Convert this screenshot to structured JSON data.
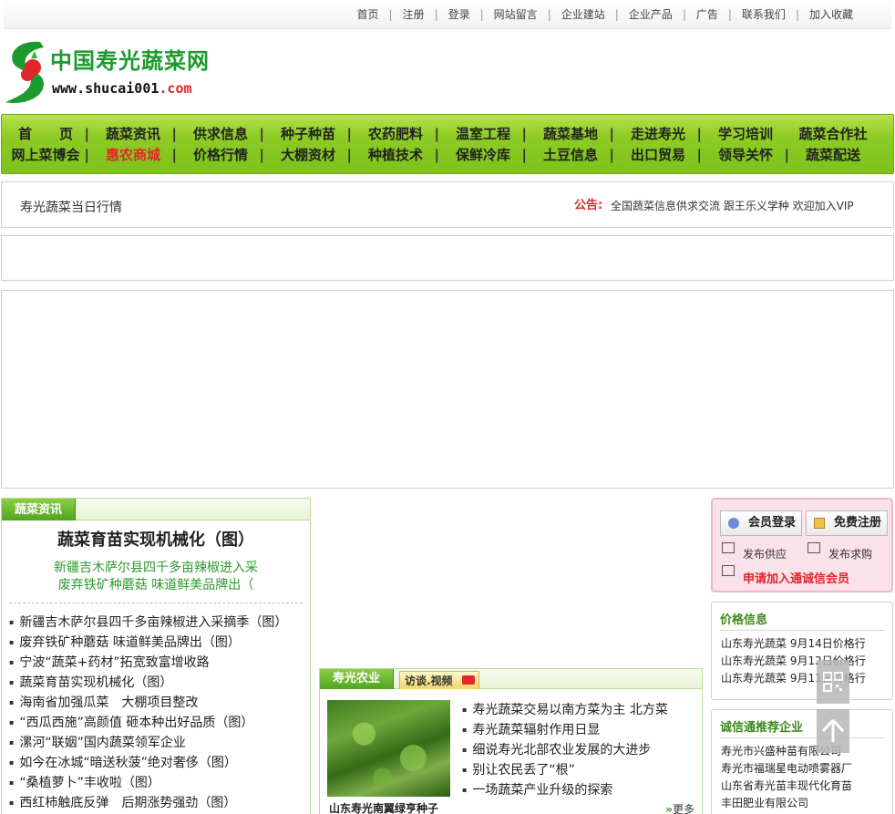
{
  "top_links": [
    "首页",
    "注册",
    "登录",
    "网站留言",
    "企业建站",
    "企业产品",
    "广告",
    "联系我们",
    "加入收藏"
  ],
  "logo": {
    "title": "中国寿光蔬菜网",
    "url_prefix": "www.shucai001",
    "url_domain": ".com"
  },
  "nav": {
    "row1": [
      "首　　页",
      "蔬菜资讯",
      "供求信息",
      "种子种苗",
      "农药肥料",
      "温室工程",
      "蔬菜基地",
      "走进寿光",
      "学习培训",
      "蔬菜合作社"
    ],
    "row2": [
      "网上菜博会",
      "惠农商城",
      "价格行情",
      "大棚资材",
      "种植技术",
      "保鲜冷库",
      "土豆信息",
      "出口贸易",
      "领导关怀",
      "蔬菜配送"
    ]
  },
  "notice": {
    "left": "寿光蔬菜当日行情",
    "label": "公告:",
    "text": "全国蔬菜信息供求交流 跟王乐义学种 欢迎加入VIP"
  },
  "news": {
    "tab": "蔬菜资讯",
    "headline": "蔬菜育苗实现机械化（图）",
    "summary": [
      "新疆吉木萨尔县四千多亩辣椒进入采",
      "废弃铁矿种蘑菇 味道鲜美品牌出（"
    ],
    "items": [
      "新疆吉木萨尔县四千多亩辣椒进入采摘季（图）",
      "废弃铁矿种蘑菇 味道鲜美品牌出（图）",
      "宁波“蔬菜+药材”拓宽致富增收路",
      "蔬菜育苗实现机械化（图）",
      "海南省加强瓜菜　大棚项目整改",
      "“西瓜西施”高颜值 砸本种出好品质（图）",
      "漯河“联姻”国内蔬菜领军企业",
      "如今在冰城“暗送秋菠”绝对奢侈（图）",
      "“桑植萝卜”丰收啦（图）",
      "西红柿触底反弹　后期涨势强劲（图）"
    ]
  },
  "agri": {
    "tab": "寿光农业",
    "tab2": "访谈.视频",
    "photo_caption": "山东寿光南翼绿亨种子",
    "items": [
      "寿光蔬菜交易以南方菜为主 北方菜",
      "寿光蔬菜辐射作用日显",
      "细说寿光北部农业发展的大进步",
      "别让农民丢了“根”",
      "一场蔬菜产业升级的探索"
    ],
    "more": "更多"
  },
  "member": {
    "login": "会员登录",
    "register": "免费注册",
    "supply": "发布供应",
    "demand": "发布求购",
    "apply": "申请加入通诚信会员"
  },
  "price": {
    "title": "价格信息",
    "items": [
      "山东寿光蔬菜 9月14日价格行",
      "山东寿光蔬菜 9月12日价格行",
      "山东寿光蔬菜 9月11日价格行"
    ]
  },
  "enterprise": {
    "title": "诚信通推荐企业",
    "items": [
      "寿光市兴盛种苗有限公司",
      "寿光市福瑞星电动喷雾器厂",
      "山东省寿光苗丰现代化育苗",
      "丰田肥业有限公司"
    ]
  },
  "colors": {
    "brand_green": "#1b9a2e",
    "nav_green": "#7cc21a",
    "accent_red": "#e3262b"
  }
}
